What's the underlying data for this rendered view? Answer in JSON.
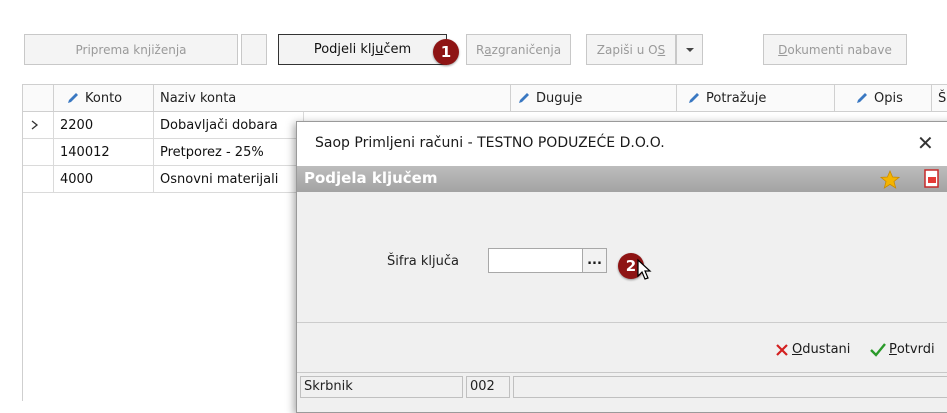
{
  "toolbar": {
    "priprema_label": "Priprema knjiženja",
    "podjeli_label_pre": "Podjeli klj",
    "podjeli_label_u": "u",
    "podjeli_label_post": "čem",
    "razgranicenja_pre": "R",
    "razgranicenja_u": "a",
    "razgranicenja_post": "zgraničenja",
    "zapisi_pre": "Zapiši u O",
    "zapisi_u": "S",
    "dokumenti_u": "D",
    "dokumenti_post": "okumenti nabave"
  },
  "badges": {
    "step1": "1",
    "step2": "2"
  },
  "grid": {
    "headers": {
      "konto": "Konto",
      "naziv": "Naziv konta",
      "duguje": "Duguje",
      "potrazuje": "Potražuje",
      "opis": "Opis",
      "extra": "Š"
    },
    "rows": [
      {
        "konto": "2200",
        "naziv": "Dobavljači dobara",
        "selected": true
      },
      {
        "konto": "140012",
        "naziv": "Pretporez - 25%"
      },
      {
        "konto": "4000",
        "naziv": "Osnovni materijali"
      }
    ]
  },
  "dialog": {
    "title": "Saop Primljeni računi - TESTNO PODUZEĆE D.O.O.",
    "close_glyph": "✕",
    "band_title": "Podjela ključem",
    "field_label": "Šifra ključa",
    "field_value": "",
    "ellipsis": "...",
    "cancel_u": "O",
    "cancel_post": "dustani",
    "confirm_u": "P",
    "confirm_post": "otvrdi",
    "status": {
      "user": "Skrbnik",
      "code": "002"
    }
  },
  "colors": {
    "badge": "#8e1414",
    "band": "#a8a8a8",
    "cancel": "#d32020",
    "confirm": "#2a9a2a"
  }
}
